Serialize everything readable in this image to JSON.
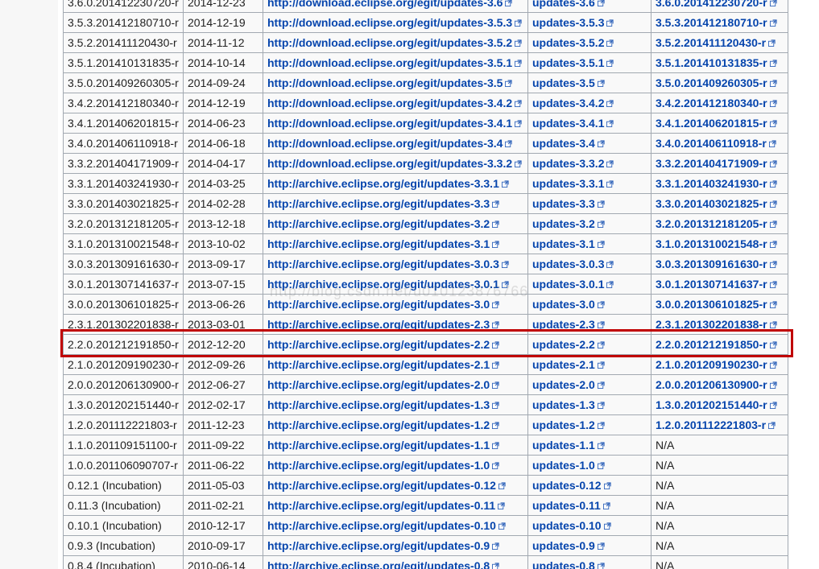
{
  "rows": [
    [
      "3.6.0.201412230720-r",
      "2014-12-23",
      "http://download.eclipse.org/egit/updates-3.6",
      "updates-3.6",
      "3.6.0.201412230720-r"
    ],
    [
      "3.5.3.201412180710-r",
      "2014-12-19",
      "http://download.eclipse.org/egit/updates-3.5.3",
      "updates-3.5.3",
      "3.5.3.201412180710-r"
    ],
    [
      "3.5.2.201411120430-r",
      "2014-11-12",
      "http://download.eclipse.org/egit/updates-3.5.2",
      "updates-3.5.2",
      "3.5.2.201411120430-r"
    ],
    [
      "3.5.1.201410131835-r",
      "2014-10-14",
      "http://download.eclipse.org/egit/updates-3.5.1",
      "updates-3.5.1",
      "3.5.1.201410131835-r"
    ],
    [
      "3.5.0.201409260305-r",
      "2014-09-24",
      "http://download.eclipse.org/egit/updates-3.5",
      "updates-3.5",
      "3.5.0.201409260305-r"
    ],
    [
      "3.4.2.201412180340-r",
      "2014-12-19",
      "http://download.eclipse.org/egit/updates-3.4.2",
      "updates-3.4.2",
      "3.4.2.201412180340-r"
    ],
    [
      "3.4.1.201406201815-r",
      "2014-06-23",
      "http://download.eclipse.org/egit/updates-3.4.1",
      "updates-3.4.1",
      "3.4.1.201406201815-r"
    ],
    [
      "3.4.0.201406110918-r",
      "2014-06-18",
      "http://download.eclipse.org/egit/updates-3.4",
      "updates-3.4",
      "3.4.0.201406110918-r"
    ],
    [
      "3.3.2.201404171909-r",
      "2014-04-17",
      "http://download.eclipse.org/egit/updates-3.3.2",
      "updates-3.3.2",
      "3.3.2.201404171909-r"
    ],
    [
      "3.3.1.201403241930-r",
      "2014-03-25",
      "http://archive.eclipse.org/egit/updates-3.3.1",
      "updates-3.3.1",
      "3.3.1.201403241930-r"
    ],
    [
      "3.3.0.201403021825-r",
      "2014-02-28",
      "http://archive.eclipse.org/egit/updates-3.3",
      "updates-3.3",
      "3.3.0.201403021825-r"
    ],
    [
      "3.2.0.201312181205-r",
      "2013-12-18",
      "http://archive.eclipse.org/egit/updates-3.2",
      "updates-3.2",
      "3.2.0.201312181205-r"
    ],
    [
      "3.1.0.201310021548-r",
      "2013-10-02",
      "http://archive.eclipse.org/egit/updates-3.1",
      "updates-3.1",
      "3.1.0.201310021548-r"
    ],
    [
      "3.0.3.201309161630-r",
      "2013-09-17",
      "http://archive.eclipse.org/egit/updates-3.0.3",
      "updates-3.0.3",
      "3.0.3.201309161630-r"
    ],
    [
      "3.0.1.201307141637-r",
      "2013-07-15",
      "http://archive.eclipse.org/egit/updates-3.0.1",
      "updates-3.0.1",
      "3.0.1.201307141637-r"
    ],
    [
      "3.0.0.201306101825-r",
      "2013-06-26",
      "http://archive.eclipse.org/egit/updates-3.0",
      "updates-3.0",
      "3.0.0.201306101825-r"
    ],
    [
      "2.3.1.201302201838-r",
      "2013-03-01",
      "http://archive.eclipse.org/egit/updates-2.3",
      "updates-2.3",
      "2.3.1.201302201838-r"
    ],
    [
      "2.2.0.201212191850-r",
      "2012-12-20",
      "http://archive.eclipse.org/egit/updates-2.2",
      "updates-2.2",
      "2.2.0.201212191850-r"
    ],
    [
      "2.1.0.201209190230-r",
      "2012-09-26",
      "http://archive.eclipse.org/egit/updates-2.1",
      "updates-2.1",
      "2.1.0.201209190230-r"
    ],
    [
      "2.0.0.201206130900-r",
      "2012-06-27",
      "http://archive.eclipse.org/egit/updates-2.0",
      "updates-2.0",
      "2.0.0.201206130900-r"
    ],
    [
      "1.3.0.201202151440-r",
      "2012-02-17",
      "http://archive.eclipse.org/egit/updates-1.3",
      "updates-1.3",
      "1.3.0.201202151440-r"
    ],
    [
      "1.2.0.201112221803-r",
      "2011-12-23",
      "http://archive.eclipse.org/egit/updates-1.2",
      "updates-1.2",
      "1.2.0.201112221803-r"
    ],
    [
      "1.1.0.201109151100-r",
      "2011-09-22",
      "http://archive.eclipse.org/egit/updates-1.1",
      "updates-1.1",
      "N/A"
    ],
    [
      "1.0.0.201106090707-r",
      "2011-06-22",
      "http://archive.eclipse.org/egit/updates-1.0",
      "updates-1.0",
      "N/A"
    ],
    [
      "0.12.1 (Incubation)",
      "2011-05-03",
      "http://archive.eclipse.org/egit/updates-0.12",
      "updates-0.12",
      "N/A"
    ],
    [
      "0.11.3 (Incubation)",
      "2011-02-21",
      "http://archive.eclipse.org/egit/updates-0.11",
      "updates-0.11",
      "N/A"
    ],
    [
      "0.10.1 (Incubation)",
      "2010-12-17",
      "http://archive.eclipse.org/egit/updates-0.10",
      "updates-0.10",
      "N/A"
    ],
    [
      "0.9.3 (Incubation)",
      "2010-09-17",
      "http://archive.eclipse.org/egit/updates-0.9",
      "updates-0.9",
      "N/A"
    ],
    [
      "0.8.4 (Incubation)",
      "2010-06-14",
      "http://archive.eclipse.org/egit/updates-0.8",
      "updates-0.8",
      "N/A"
    ]
  ],
  "highlighted_row_version": "2.2.0.201212191850-r",
  "watermark_text": "http://blog.csdn.net/u010123876766",
  "colors": {
    "link": "#0645ad",
    "border": "#a2a9b1",
    "highlight": "#c00000"
  },
  "icons": {
    "external_link": "external-link-icon"
  }
}
